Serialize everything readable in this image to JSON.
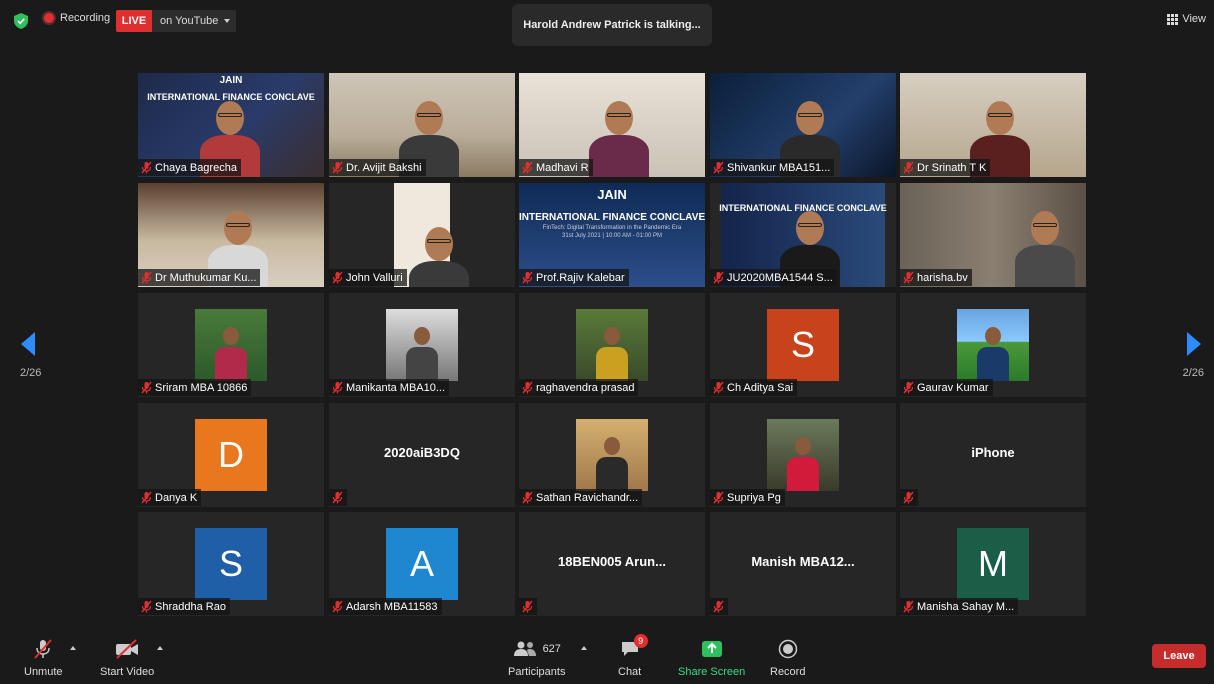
{
  "topbar": {
    "recording_label": "Recording",
    "live_label": "LIVE",
    "stream_target": "on YouTube",
    "talking_text": "Harold Andrew Patrick is talking...",
    "view_label": "View"
  },
  "paging": {
    "left": "2/26",
    "right": "2/26"
  },
  "participants": [
    {
      "name": "Chaya Bagrecha",
      "kind": "video",
      "slide": {
        "title": "INTERNATIONAL FINANCE CONCLAVE",
        "brand": "JAIN"
      }
    },
    {
      "name": "Dr. Avijit Bakshi",
      "kind": "video"
    },
    {
      "name": "Madhavi R",
      "kind": "video"
    },
    {
      "name": "Shivankur MBA151...",
      "kind": "video"
    },
    {
      "name": "Dr Srinath T K",
      "kind": "video"
    },
    {
      "name": "Dr Muthukumar Ku...",
      "kind": "video"
    },
    {
      "name": "John Valluri",
      "kind": "video"
    },
    {
      "name": "Prof.Rajiv Kalebar",
      "kind": "video",
      "slide": {
        "title": "INTERNATIONAL FINANCE CONCLAVE",
        "brand": "JAIN",
        "subtitle": "FinTech: Digital Transformation in the Pandemic Era",
        "date": "31st July 2021 | 10:00 AM - 01:00 PM"
      }
    },
    {
      "name": "JU2020MBA1544 S...",
      "kind": "video",
      "slide": {
        "title": "INTERNATIONAL FINANCE CONCLAVE"
      }
    },
    {
      "name": "harisha.bv",
      "kind": "video"
    },
    {
      "name": "Sriram MBA 10866",
      "kind": "photo"
    },
    {
      "name": "Manikanta MBA10...",
      "kind": "photo"
    },
    {
      "name": "raghavendra prasad",
      "kind": "photo"
    },
    {
      "name": "Ch Aditya Sai",
      "kind": "letter",
      "letter": "S",
      "color": "#c8431c"
    },
    {
      "name": "Gaurav Kumar",
      "kind": "photo"
    },
    {
      "name": "Danya K",
      "kind": "letter",
      "letter": "D",
      "color": "#e8771e"
    },
    {
      "name": "2020aiB3DQ",
      "kind": "text"
    },
    {
      "name": "Sathan Ravichandr...",
      "kind": "photo"
    },
    {
      "name": "Supriya Pg",
      "kind": "photo"
    },
    {
      "name": "iPhone",
      "kind": "text"
    },
    {
      "name": "Shraddha Rao",
      "kind": "letter",
      "letter": "S",
      "color": "#1e5fa8"
    },
    {
      "name": "Adarsh MBA11583",
      "kind": "letter",
      "letter": "A",
      "color": "#1f86d0"
    },
    {
      "name": "18BEN005 Arun...",
      "kind": "text"
    },
    {
      "name": "Manish  MBA12...",
      "kind": "text"
    },
    {
      "name": "Manisha Sahay  M...",
      "kind": "letter",
      "letter": "M",
      "color": "#1b5e48"
    }
  ],
  "toolbar": {
    "unmute": "Unmute",
    "start_video": "Start Video",
    "participants_label": "Participants",
    "participants_count": "627",
    "chat_label": "Chat",
    "chat_badge": "9",
    "share_label": "Share Screen",
    "record_label": "Record",
    "leave_label": "Leave"
  },
  "colors": {
    "accent": "#2d8cff",
    "live": "#e02f2f",
    "share": "#3ddc84",
    "leave": "#c52d2d"
  }
}
